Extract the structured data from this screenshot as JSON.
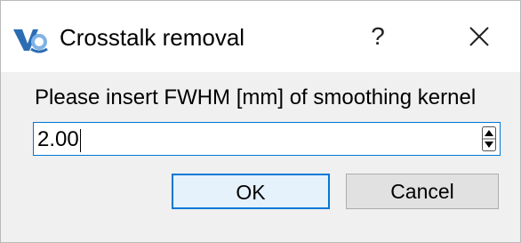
{
  "window": {
    "title": "Crosstalk removal",
    "help_label": "?",
    "app_icon": "vr-app-icon",
    "close_icon": "close-icon"
  },
  "dialog": {
    "prompt": "Please insert FWHM [mm] of smoothing kernel",
    "value": "2.00",
    "ok_label": "OK",
    "cancel_label": "Cancel"
  },
  "colors": {
    "accent": "#0078d7",
    "client_bg": "#f0f0f0",
    "button_bg": "#e1e1e1",
    "ok_bg": "#e5f1fb"
  }
}
